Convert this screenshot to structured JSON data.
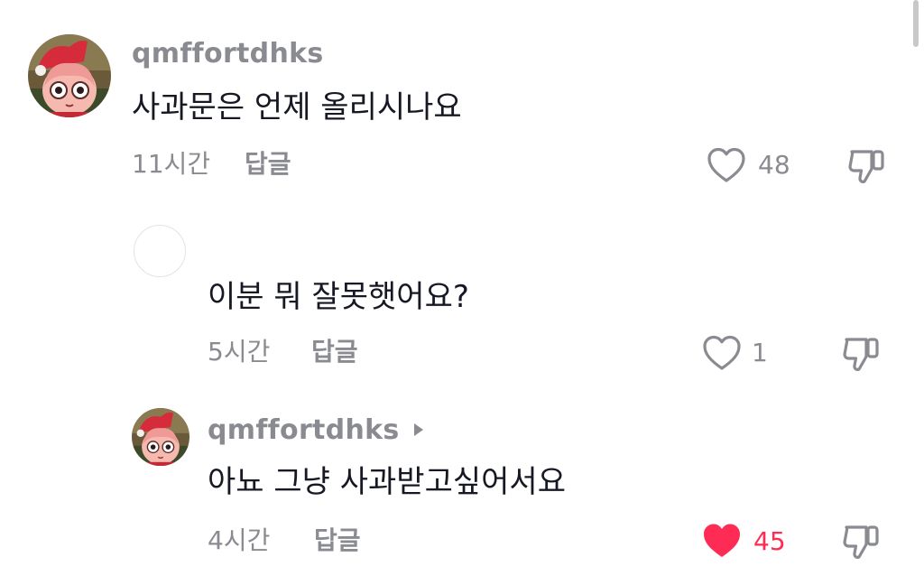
{
  "comments": [
    {
      "username": "qmffortdhks",
      "text": "사과문은 언제 올리시나요",
      "time": "11시간",
      "reply_label": "답글",
      "like_count": "48",
      "liked": false
    },
    {
      "username": "",
      "text": "이분 뭐 잘못햇어요?",
      "time": "5시간",
      "reply_label": "답글",
      "like_count": "1",
      "liked": false
    },
    {
      "username": "qmffortdhks",
      "text": "아뇨 그냥 사과받고싶어서요",
      "time": "4시간",
      "reply_label": "답글",
      "like_count": "45",
      "liked": true
    }
  ],
  "icons": {
    "like": "heart-outline-icon",
    "liked": "heart-filled-icon",
    "dislike": "thumbs-down-icon",
    "reply_arrow": "caret-right-icon"
  },
  "colors": {
    "liked": "#fe2c55",
    "muted_text": "#8a8b91",
    "primary_text": "#161823"
  }
}
